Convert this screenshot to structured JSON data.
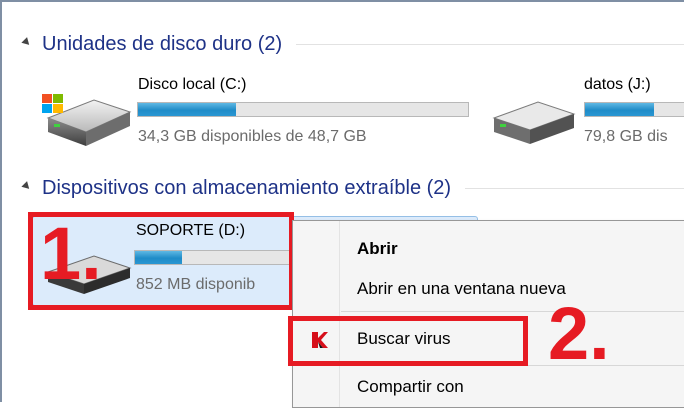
{
  "groups": {
    "hard_disks": {
      "title": "Unidades de disco duro (2)"
    },
    "removable": {
      "title": "Dispositivos con almacenamiento extraíble (2)"
    }
  },
  "drives": {
    "c": {
      "name": "Disco local (C:)",
      "free_text": "34,3 GB disponibles de 48,7 GB",
      "used_fraction": 0.296,
      "icon": "windows-hdd-icon"
    },
    "j": {
      "name": "datos (J:)",
      "free_text": "79,8 GB dis",
      "icon": "hdd-icon"
    },
    "d": {
      "name": "SOPORTE (D:)",
      "free_text": "852 MB disponib",
      "used_fraction": 0.24,
      "icon": "usb-drive-icon"
    }
  },
  "context_menu": {
    "open": "Abrir",
    "open_new_window": "Abrir en una ventana nueva",
    "scan": "Buscar virus",
    "share": "Compartir con",
    "scan_icon": "kaspersky-k-icon"
  },
  "annotations": {
    "step1": "1.",
    "step2": "2.",
    "color": "#e61b23"
  }
}
